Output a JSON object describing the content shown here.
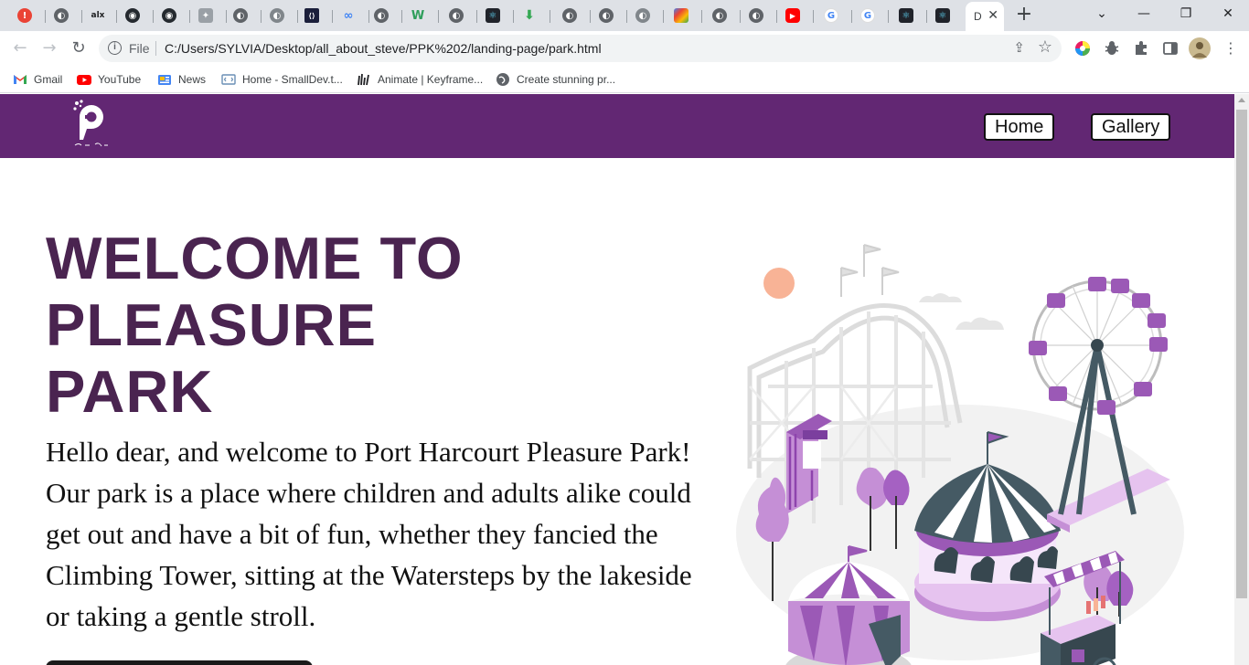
{
  "browser": {
    "active_tab_letter": "D",
    "new_tab_symbol": "+",
    "window_controls": {
      "dropdown": "⌄",
      "minimize": "—",
      "restore": "❐",
      "close": "✕"
    },
    "address_bar": {
      "scheme_label": "File",
      "url": "C:/Users/SYLVIA/Desktop/all_about_steve/PPK%202/landing-page/park.html"
    },
    "bookmarks": [
      {
        "label": "Gmail",
        "icon": "gmail-icon"
      },
      {
        "label": "YouTube",
        "icon": "youtube-icon"
      },
      {
        "label": "News",
        "icon": "news-icon"
      },
      {
        "label": "Home - SmallDev.t...",
        "icon": "smalldev-icon"
      },
      {
        "label": "Animate | Keyframe...",
        "icon": "keyframe-icon"
      },
      {
        "label": "Create stunning pr...",
        "icon": "globe-icon"
      }
    ]
  },
  "site": {
    "brand_color": "#622773",
    "title_color": "#4a2450",
    "nav": [
      {
        "label": "Home"
      },
      {
        "label": "Gallery"
      }
    ],
    "hero": {
      "title": "WELCOME TO PLEASURE PARK",
      "text": "Hello dear, and welcome to Port Harcourt Pleasure Park! Our park is a place where children and adults alike could get out and have a bit of fun, whether they fancied the Climbing Tower, sitting at the Watersteps by the lakeside or taking a gentle stroll."
    }
  }
}
